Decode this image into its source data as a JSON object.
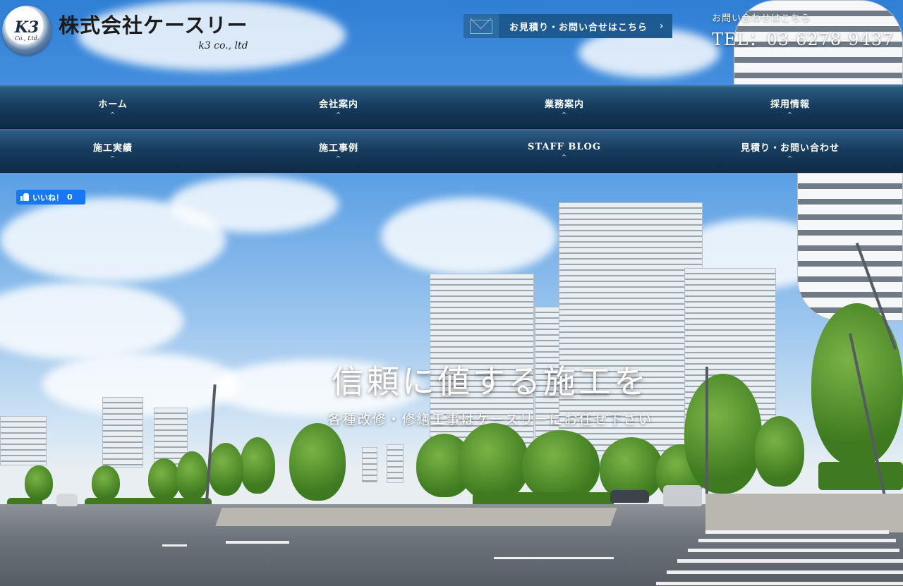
{
  "header": {
    "logo_mark": "K3",
    "logo_mark_sub": "Co., Ltd.",
    "company_name": "株式会社ケースリー",
    "company_sub": "k3 co., ltd",
    "inquiry_button": "お見積り・お問い合せはこちら",
    "inquiry_arrow": "›",
    "tel_caption": "お問い合わせはこちら",
    "tel_number": "TEL：03-6278-9437"
  },
  "nav": {
    "row1": [
      {
        "label": "ホーム"
      },
      {
        "label": "会社案内"
      },
      {
        "label": "業務案内"
      },
      {
        "label": "採用情報"
      }
    ],
    "row2": [
      {
        "label": "施工実績"
      },
      {
        "label": "施工事例"
      },
      {
        "label": "STAFF BLOG"
      },
      {
        "label": "見積り・お問い合わせ"
      }
    ],
    "caret": "^"
  },
  "like": {
    "label": "いいね！",
    "count": "0",
    "color": "#1877f2"
  },
  "hero": {
    "title": "信頼に値する施工を",
    "subtitle": "各種改修・修繕工事はケースリーにお任せ下さい"
  },
  "colors": {
    "nav_bg": "#173d5f",
    "inquiry_bg": "#1d5a91"
  }
}
